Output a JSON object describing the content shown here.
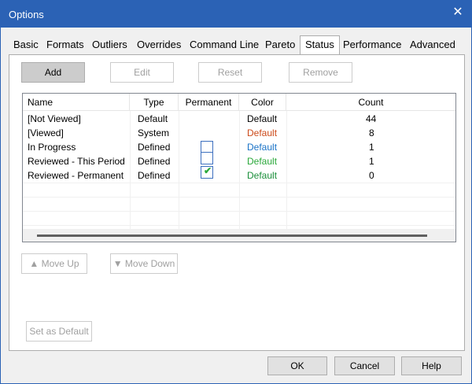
{
  "window": {
    "title": "Options"
  },
  "tabs": [
    "Basic",
    "Formats",
    "Outliers",
    "Overrides",
    "Command Line",
    "Pareto",
    "Status",
    "Performance",
    "Advanced"
  ],
  "active_tab": "Status",
  "toolbar": {
    "add": "Add",
    "edit": "Edit",
    "reset": "Reset",
    "remove": "Remove"
  },
  "table": {
    "columns": [
      "Name",
      "Type",
      "Permanent",
      "Color",
      "Count"
    ],
    "rows": [
      {
        "name": "[Not Viewed]",
        "type": "Default",
        "permanent": null,
        "color_label": "Default",
        "color_hex": "#000000",
        "count": "44"
      },
      {
        "name": "[Viewed]",
        "type": "System",
        "permanent": null,
        "color_label": "Default",
        "color_hex": "#cc4a1a",
        "count": "8"
      },
      {
        "name": "In Progress",
        "type": "Defined",
        "permanent": false,
        "color_label": "Default",
        "color_hex": "#1a73c7",
        "count": "1"
      },
      {
        "name": "Reviewed - This Period",
        "type": "Defined",
        "permanent": false,
        "color_label": "Default",
        "color_hex": "#2aa83a",
        "count": "1"
      },
      {
        "name": "Reviewed - Permanent",
        "type": "Defined",
        "permanent": true,
        "color_label": "Default",
        "color_hex": "#1a8f3a",
        "count": "0"
      }
    ]
  },
  "move": {
    "up": "▲ Move Up",
    "down": "▼ Move Down"
  },
  "set_default": "Set as Default",
  "footer": {
    "ok": "OK",
    "cancel": "Cancel",
    "help": "Help"
  },
  "icons": {
    "close": "close-icon",
    "check": "checkmark-icon"
  }
}
